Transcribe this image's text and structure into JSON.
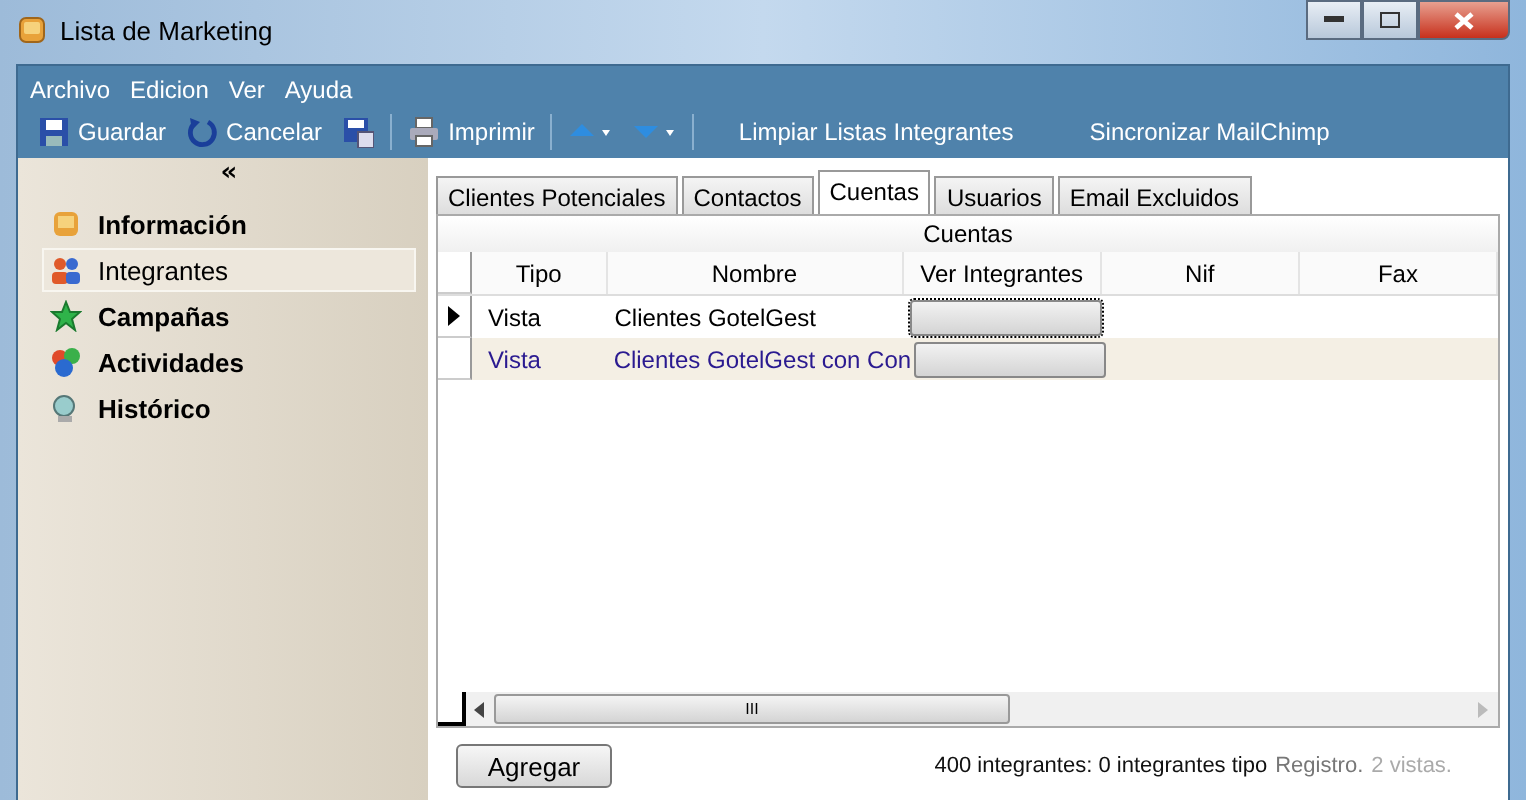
{
  "window": {
    "title": "Lista de Marketing"
  },
  "menu": [
    "Archivo",
    "Edicion",
    "Ver",
    "Ayuda"
  ],
  "toolbar": [
    {
      "kind": "save",
      "label": "Guardar"
    },
    {
      "kind": "undo",
      "label": "Cancelar"
    },
    {
      "kind": "saveas"
    },
    {
      "kind": "sep"
    },
    {
      "kind": "print",
      "label": "Imprimir"
    },
    {
      "kind": "sep"
    },
    {
      "kind": "up"
    },
    {
      "kind": "down"
    },
    {
      "kind": "sep"
    },
    {
      "kind": "text",
      "label": "Limpiar Listas Integrantes"
    },
    {
      "kind": "text",
      "label": "Sincronizar MailChimp"
    }
  ],
  "sidebar": {
    "collapse": "«",
    "items": [
      {
        "kind": "book",
        "label": "Información",
        "selected": false
      },
      {
        "kind": "people",
        "label": "Integrantes",
        "selected": true
      },
      {
        "kind": "star",
        "label": "Campañas",
        "selected": false
      },
      {
        "kind": "balls",
        "label": "Actividades",
        "selected": false
      },
      {
        "kind": "history",
        "label": "Histórico",
        "selected": false
      }
    ]
  },
  "tabs": [
    {
      "label": "Clientes Potenciales",
      "selected": false
    },
    {
      "label": "Contactos",
      "selected": false
    },
    {
      "label": "Cuentas",
      "selected": true
    },
    {
      "label": "Usuarios",
      "selected": false
    },
    {
      "label": "Email Excluidos",
      "selected": false
    }
  ],
  "table": {
    "caption": "Cuentas",
    "columns": [
      "Tipo",
      "Nombre",
      "Ver Integrantes",
      "Nif",
      "Fax"
    ],
    "rows": [
      {
        "current": true,
        "tipo": "Vista",
        "nombre": "Clientes GotelGest"
      },
      {
        "current": false,
        "tipo": "Vista",
        "nombre": "Clientes GotelGest con Con"
      }
    ],
    "scroll_grip": "III"
  },
  "add_button": "Agregar",
  "status": {
    "count": "400 integrantes: 0 integrantes tipo",
    "kind": "Registro.",
    "views": "2 vistas."
  }
}
